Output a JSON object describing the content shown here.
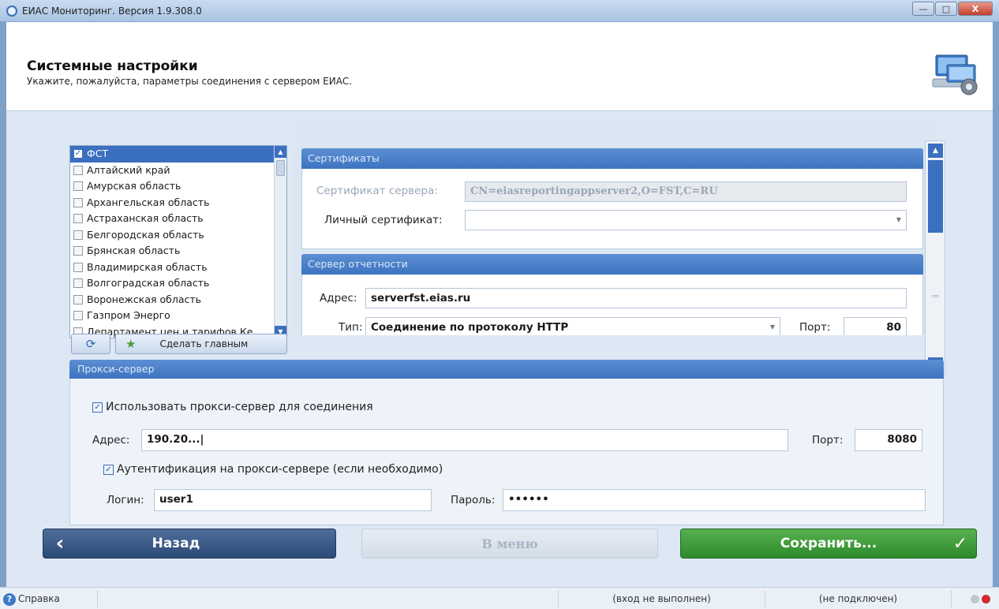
{
  "window": {
    "title": "ЕИАС Мониторинг. Версия 1.9.308.0",
    "minimize": "—",
    "maximize": "□",
    "close": "X"
  },
  "header": {
    "title": "Системные настройки",
    "subtitle": "Укажите, пожалуйста, параметры соединения с сервером ЕИАС."
  },
  "regions": {
    "items": [
      {
        "label": "ФСТ",
        "checked": true,
        "selected": true
      },
      {
        "label": "Алтайский край",
        "checked": false
      },
      {
        "label": "Амурская область",
        "checked": false
      },
      {
        "label": "Архангельская область",
        "checked": false
      },
      {
        "label": "Астраханская область",
        "checked": false
      },
      {
        "label": "Белгородская область",
        "checked": false
      },
      {
        "label": "Брянская область",
        "checked": false
      },
      {
        "label": "Владимирская область",
        "checked": false
      },
      {
        "label": "Волгоградская область",
        "checked": false
      },
      {
        "label": "Воронежская область",
        "checked": false
      },
      {
        "label": "Газпром Энерго",
        "checked": false
      },
      {
        "label": "Департамент цен и тарифов Ке",
        "checked": false
      }
    ],
    "make_main_label": "Сделать главным"
  },
  "certificates": {
    "header": "Сертификаты",
    "server_cert_label": "Сертификат сервера:",
    "server_cert_value": "CN=eiasreportingappserver2,O=FST,C=RU",
    "personal_cert_label": "Личный сертификат:",
    "personal_cert_value": ""
  },
  "report_server": {
    "header": "Сервер отчетности",
    "address_label": "Адрес:",
    "address_value": "serverfst.eias.ru",
    "type_label": "Тип:",
    "type_value": "Соединение по протоколу HTTP",
    "port_label": "Порт:",
    "port_value": "80"
  },
  "proxy": {
    "header": "Прокси-сервер",
    "use_proxy_label": "Использовать прокси-сервер для соединения",
    "use_proxy_checked": true,
    "address_label": "Адрес:",
    "address_value": "190.20...",
    "port_label": "Порт:",
    "port_value": "8080",
    "auth_label": "Аутентификация на прокси-сервере (если необходимо)",
    "auth_checked": true,
    "login_label": "Логин:",
    "login_value": "user1",
    "password_label": "Пароль:",
    "password_value": "••••••"
  },
  "buttons": {
    "back": "Назад",
    "menu": "В меню",
    "save": "Сохранить..."
  },
  "status": {
    "help": "Справка",
    "login_state": "(вход не выполнен)",
    "connection_state": "(не подключен)"
  },
  "colors": {
    "accent": "#3b6fbf",
    "save": "#3c9a36",
    "back": "#3a5a88",
    "status_off": "#c0c6cf",
    "status_err": "#d12a2a"
  }
}
